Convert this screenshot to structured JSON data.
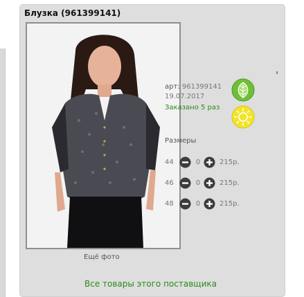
{
  "product": {
    "title": "Блузка (961399141)",
    "art_label": "арт:",
    "art_value": "961399141",
    "date": "19.07.2017",
    "ordered": "Заказано 5 раз",
    "more_photos": "Ещё фото",
    "supplier_link": "Все товары этого поставщика"
  },
  "sizes": {
    "title": "Размеры",
    "rows": [
      {
        "size": "44",
        "qty": "0",
        "price": "215р."
      },
      {
        "size": "46",
        "qty": "0",
        "price": "215р."
      },
      {
        "size": "48",
        "qty": "0",
        "price": "215р."
      }
    ]
  },
  "colors": {
    "leaf_badge": "#6fbe3a",
    "sun_badge": "#f2e428",
    "link_green": "#2a8a1a",
    "card_bg": "#dedede"
  },
  "icons": {
    "leaf": "leaf-icon",
    "sun": "sun-icon",
    "minus": "minus-circle-icon",
    "plus": "plus-circle-icon"
  }
}
